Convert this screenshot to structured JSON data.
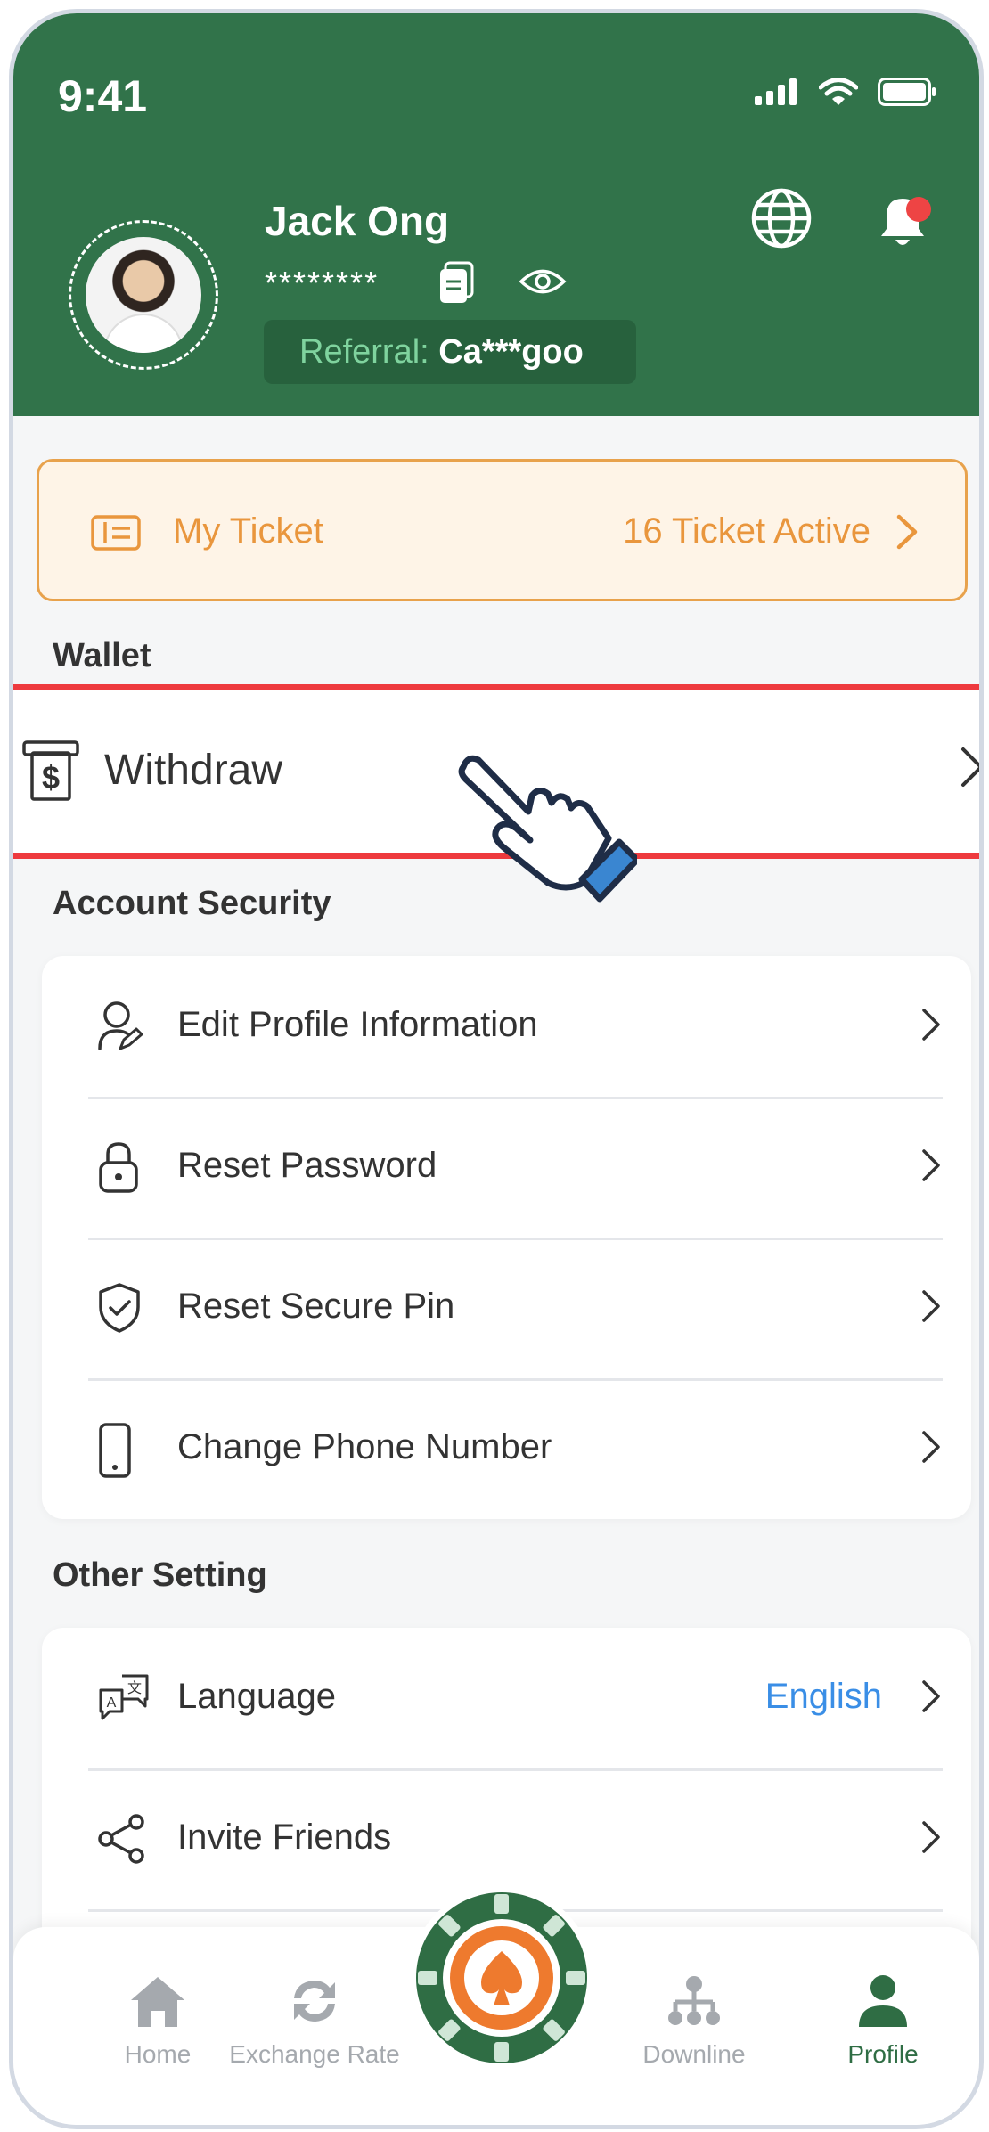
{
  "status_bar": {
    "time": "9:41"
  },
  "profile": {
    "name": "Jack Ong",
    "masked_id": "********",
    "referral_label": "Referral: ",
    "referral_code": "Ca***goo"
  },
  "ticket": {
    "label": "My Ticket",
    "count": "16 Ticket Active"
  },
  "wallet": {
    "title": "Wallet",
    "withdraw_label": "Withdraw"
  },
  "account_security": {
    "title": "Account Security",
    "items": [
      {
        "label": "Edit Profile Information",
        "icon": "user-edit-icon"
      },
      {
        "label": "Reset Password",
        "icon": "lock-icon"
      },
      {
        "label": "Reset Secure Pin",
        "icon": "shield-check-icon"
      },
      {
        "label": "Change Phone Number",
        "icon": "phone-icon"
      }
    ]
  },
  "other_setting": {
    "title": "Other Setting",
    "items": [
      {
        "label": "Language",
        "value": "English",
        "icon": "translate-icon"
      },
      {
        "label": "Invite Friends",
        "icon": "share-icon"
      }
    ]
  },
  "bottom_nav": {
    "items": [
      {
        "label": "Home",
        "icon": "home-icon"
      },
      {
        "label": "Exchange Rate",
        "icon": "exchange-icon"
      },
      {
        "label": "Downline",
        "icon": "downline-icon"
      },
      {
        "label": "Profile",
        "icon": "profile-icon",
        "active": true
      }
    ]
  },
  "colors": {
    "header_green": "#31734a",
    "ticket_orange": "#e9963d",
    "highlight_red": "#ee3a3e",
    "link_blue": "#3a8ee6",
    "active_green": "#2f6d44"
  }
}
